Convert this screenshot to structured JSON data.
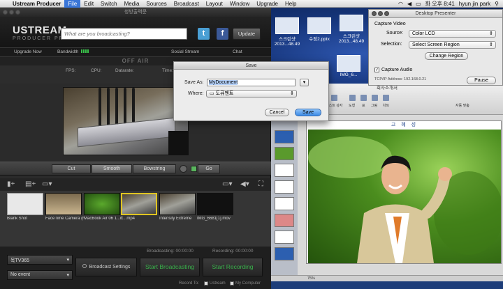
{
  "menubar": {
    "app_name": "Ustream Producer",
    "items": [
      "File",
      "Edit",
      "Switch",
      "Media",
      "Sources",
      "Broadcast",
      "Layout",
      "Window",
      "Upgrade",
      "Help"
    ],
    "active_item": "File",
    "clock": "화 오후 8:41",
    "user": "hyun jin park"
  },
  "desktop": {
    "files": [
      {
        "name": "스크린샷 2013...48.49"
      },
      {
        "name": "수정2.pptx"
      },
      {
        "name": "스크린샷 2013...48.49"
      },
      {
        "name": "IMG_6..."
      }
    ]
  },
  "ustream": {
    "title": "청방출력문",
    "logo_main": "USTREAM",
    "logo_sub": "PRODUCER PRO",
    "search_placeholder": "What are you broadcasting?",
    "update_label": "Update",
    "upgrade_now": "Upgrade Now",
    "bandwidth_label": "Bandwidth",
    "social_stream": "Social Stream",
    "chat": "Chat",
    "off_air": "OFF AIR",
    "stats": {
      "fps": "FPS:",
      "cpu": "CPU:",
      "datarate": "Datarate:",
      "time": "Time:"
    },
    "transitions": {
      "cut": "Cut",
      "smooth": "Smooth",
      "bowstring": "Bowstring",
      "go": "Go"
    },
    "shots": [
      {
        "label": "Blank Shot"
      },
      {
        "label": "FaceTime Camera (hyun..."
      },
      {
        "label": "MacBook Air 06 1...mp4"
      },
      {
        "label": "1...mp4"
      },
      {
        "label": "Intensity Extreme"
      },
      {
        "label": "IMG_6681[1].mov"
      }
    ],
    "broadcasting_time": "Broadcasting: 00:00:00",
    "recording_time": "Recording: 00:00:00",
    "channel": "목TV365",
    "event": "No event",
    "broadcast_settings": "Broadcast Settings",
    "start_broadcasting": "Start Broadcasting",
    "start_recording": "Start Recording",
    "record_to": "Record To:",
    "record_ustream": "Ustream",
    "record_computer": "My Computer"
  },
  "save_dialog": {
    "title": "Save",
    "save_as_label": "Save As:",
    "save_as_value": "MyDocument",
    "where_label": "Where:",
    "where_value": "도큐멘트",
    "cancel": "Cancel",
    "save": "Save"
  },
  "presenter": {
    "title": "Desktop Presenter",
    "capture_video": "Capture Video",
    "source_label": "Source:",
    "source_value": "Color LCD",
    "selection_label": "Selection:",
    "selection_value": "Select Screen Region",
    "change_region": "Change Region",
    "capture_audio": "Capture Audio",
    "ip": "TCP/IP Address: 192.168.0.21",
    "pause": "Pause"
  },
  "ppt": {
    "title": "회사소개서",
    "ribbon_labels": [
      "텍스트 상자",
      "도형",
      "표",
      "그림",
      "차트",
      "자동 맞춤"
    ],
    "slide_heading": "고 혜 성",
    "zoom": "75%"
  }
}
